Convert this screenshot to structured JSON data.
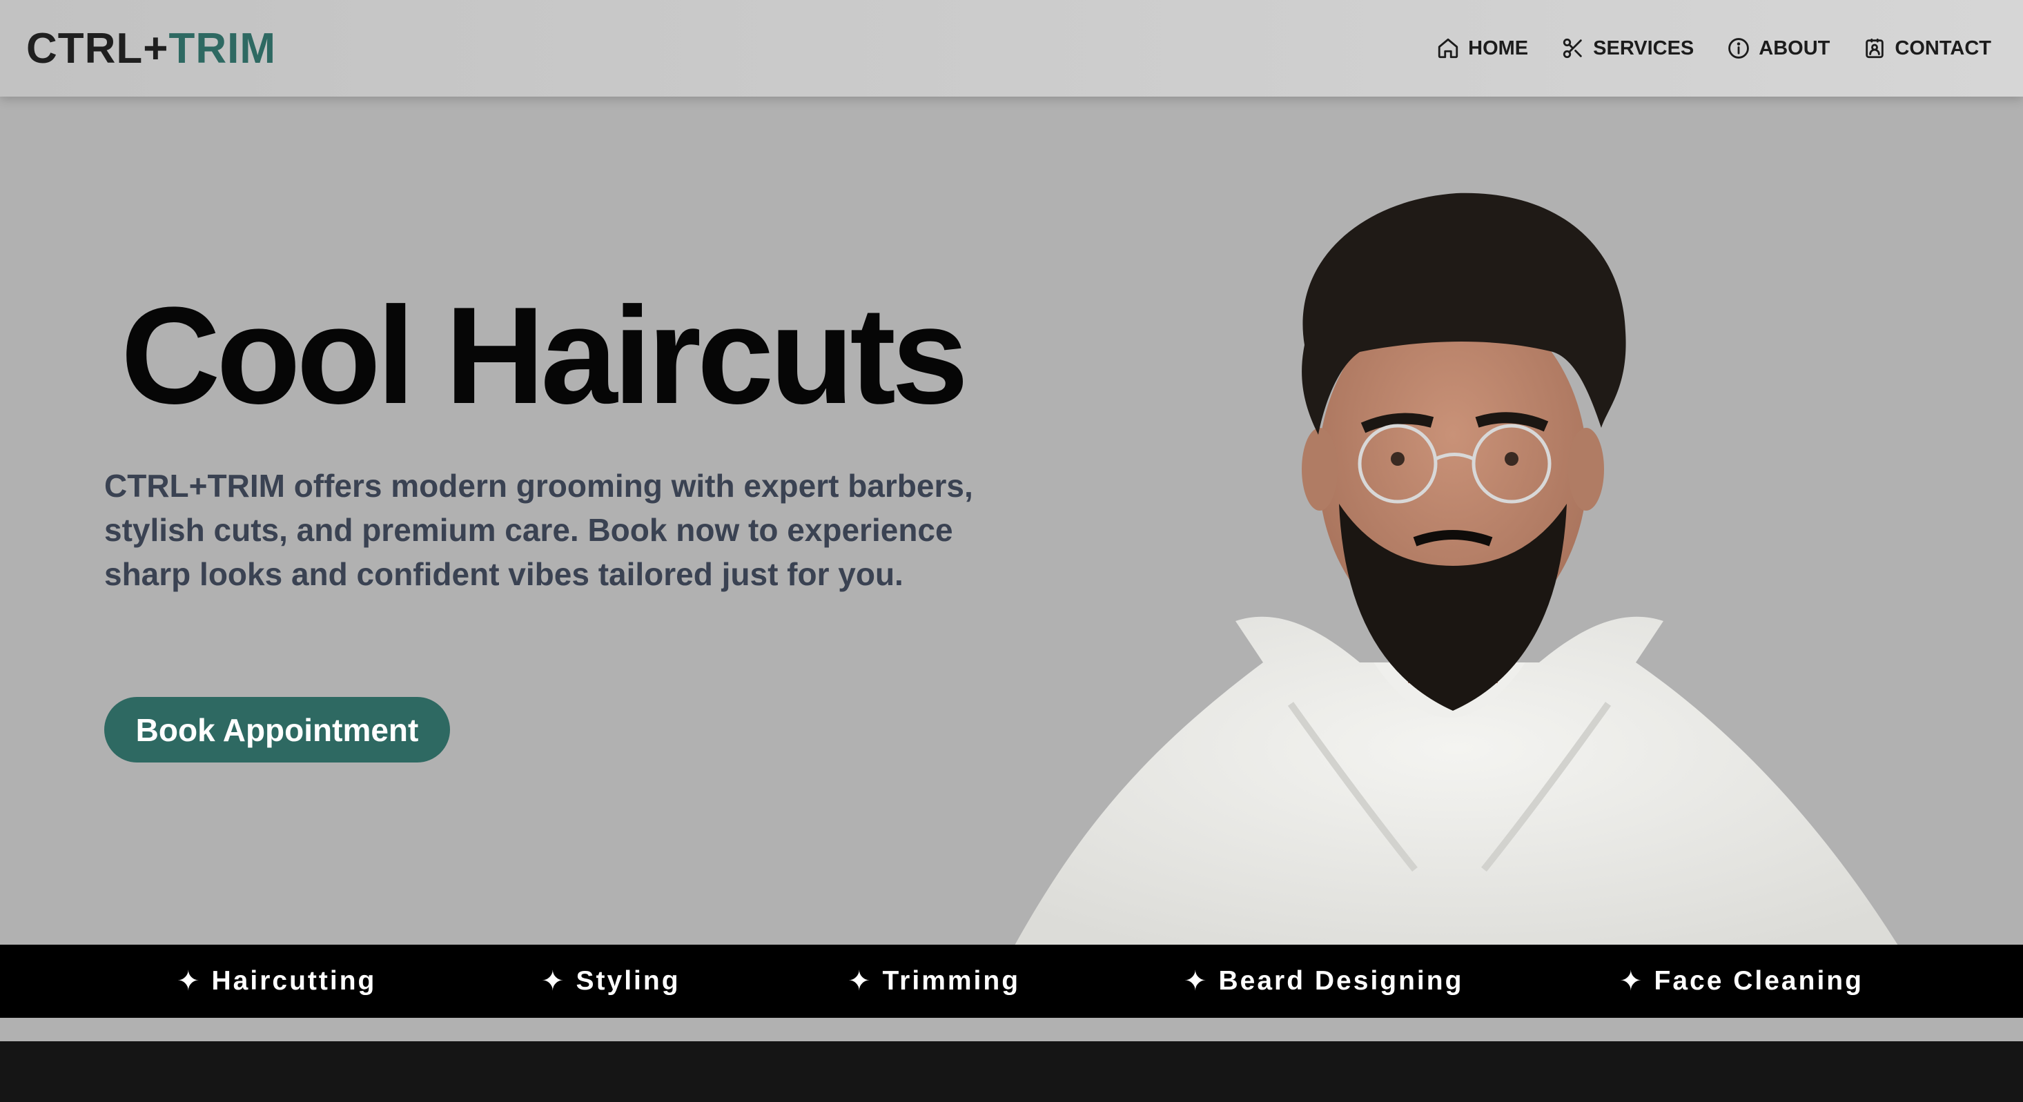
{
  "brand": {
    "part1": "CTRL+",
    "part2": "TRIM"
  },
  "nav": [
    {
      "label": "HOME",
      "icon": "home-icon"
    },
    {
      "label": "SERVICES",
      "icon": "scissors-icon"
    },
    {
      "label": "ABOUT",
      "icon": "info-icon"
    },
    {
      "label": "CONTACT",
      "icon": "contact-badge-icon"
    }
  ],
  "hero": {
    "title": "Cool Haircuts",
    "description": "CTRL+TRIM offers modern grooming with expert barbers, stylish cuts, and premium care. Book now to experience sharp looks and confident vibes tailored just for you.",
    "cta": "Book Appointment"
  },
  "services_ticker": [
    {
      "label": "Haircutting",
      "icon": "sparkle-icon"
    },
    {
      "label": "Styling",
      "icon": "sparkle-icon"
    },
    {
      "label": "Trimming",
      "icon": "sparkle-icon"
    },
    {
      "label": "Beard Designing",
      "icon": "sparkle-icon"
    },
    {
      "label": "Face Cleaning",
      "icon": "sparkle-icon"
    }
  ],
  "colors": {
    "accent": "#2e6962",
    "background": "#b1b1b1",
    "nav_text": "#1c1c1c",
    "ticker_bg": "#000000",
    "footer_bg": "#151515"
  }
}
